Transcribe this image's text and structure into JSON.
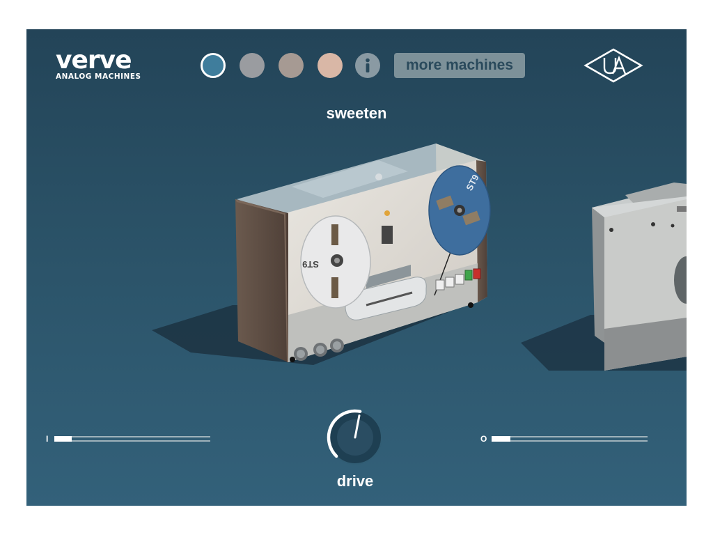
{
  "logo": {
    "word": "verve",
    "subtitle": "ANALOG MACHINES"
  },
  "theme_swatches": [
    {
      "name": "blue",
      "color": "#3f7d9c",
      "selected": true
    },
    {
      "name": "grey",
      "color": "#9a9ca0",
      "selected": false
    },
    {
      "name": "taupe",
      "color": "#a69a93",
      "selected": false
    },
    {
      "name": "peach",
      "color": "#d9b7a6",
      "selected": false
    }
  ],
  "info_label": "i",
  "more_machines_label": "more machines",
  "preset_name": "sweeten",
  "machine": {
    "reel_label": "ST9"
  },
  "input_meter": {
    "label": "I",
    "level": 0.11
  },
  "output_meter": {
    "label": "O",
    "level": 0.12
  },
  "drive": {
    "label": "drive",
    "value": 0.54
  },
  "colors": {
    "accent": "#ffffff",
    "background": "#2a5166"
  }
}
